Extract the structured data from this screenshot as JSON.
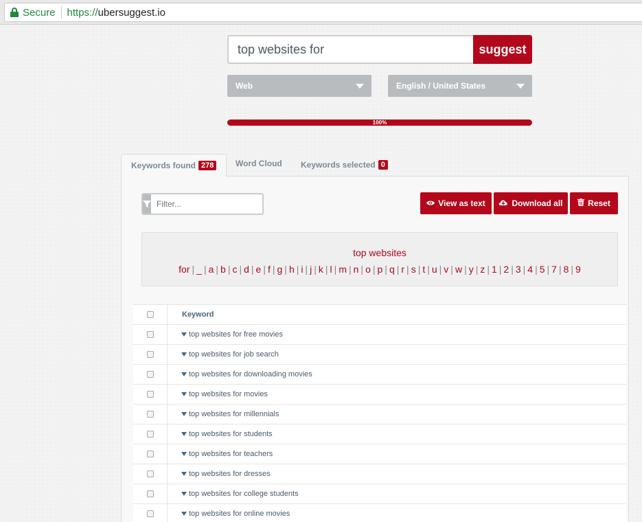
{
  "browser": {
    "secure_label": "Secure",
    "url_protocol": "https://",
    "url_host": "ubersuggest.io"
  },
  "search": {
    "query": "top websites for",
    "submit_label": "suggest",
    "source_select": "Web",
    "language_select": "English / United States",
    "progress_value": 100,
    "progress_label": "100%"
  },
  "tabs": [
    {
      "label": "Keywords found",
      "count": "278"
    },
    {
      "label": "Word Cloud"
    },
    {
      "label": "Keywords selected",
      "count": "0"
    }
  ],
  "toolbar": {
    "filter_placeholder": "Filter...",
    "view_as_text": "View as text",
    "download_all": "Download all",
    "reset": "Reset"
  },
  "alphabet": {
    "prefix": "top websites for",
    "letters": [
      "_",
      "a",
      "b",
      "c",
      "d",
      "e",
      "f",
      "g",
      "h",
      "i",
      "j",
      "k",
      "l",
      "m",
      "n",
      "o",
      "p",
      "q",
      "r",
      "s",
      "t",
      "u",
      "v",
      "w",
      "y",
      "z",
      "1",
      "2",
      "3",
      "4",
      "5",
      "7",
      "8",
      "9"
    ]
  },
  "table": {
    "header": "Keyword",
    "rows": [
      "top websites for free movies",
      "top websites for job search",
      "top websites for downloading movies",
      "top websites for movies",
      "top websites for millennials",
      "top websites for students",
      "top websites for teachers",
      "top websites for dresses",
      "top websites for college students",
      "top websites for online movies"
    ]
  },
  "colors": {
    "accent": "#b3081b",
    "select_grey": "#b9bcbf",
    "secure_green": "#1e8a3a"
  }
}
